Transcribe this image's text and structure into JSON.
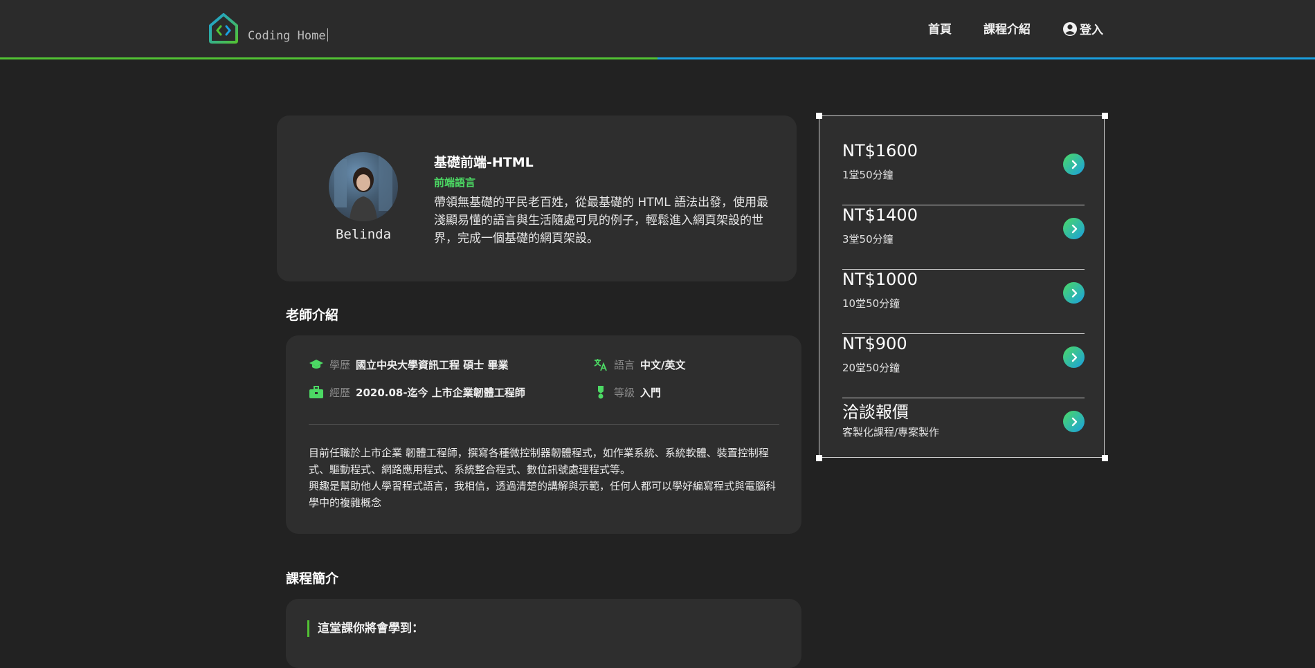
{
  "header": {
    "brand": "Coding Home",
    "nav": [
      {
        "label": "首頁"
      },
      {
        "label": "課程介紹"
      },
      {
        "label": "登入"
      }
    ],
    "accent_colors": [
      "#52c234",
      "#1a9fe0"
    ]
  },
  "course": {
    "teacher_name": "Belinda",
    "title": "基礎前端-HTML",
    "tag": "前端語言",
    "description": "帶領無基礎的平民老百姓，從最基礎的 HTML 語法出發，使用最淺顯易懂的語言與生活隨處可見的例子，輕鬆進入網頁架設的世界，完成一個基礎的網頁架設。"
  },
  "teacher_section": {
    "heading": "老師介紹",
    "education": {
      "icon": "graduation-cap-icon",
      "label": "學歷",
      "value": "國立中央大學資訊工程 碩士 畢業"
    },
    "language": {
      "icon": "translate-icon",
      "label": "語言",
      "value": "中文/英文"
    },
    "experience": {
      "icon": "briefcase-icon",
      "label": "經歷",
      "value": "2020.08-迄今 上市企業韌體工程師"
    },
    "level": {
      "icon": "award-icon",
      "label": "等級",
      "value": "入門"
    },
    "bio_line1": "目前任職於上市企業 韌體工程師，撰寫各種微控制器韌體程式，如作業系統、系統軟體、裝置控制程式、驅動程式、網路應用程式、系統整合程式、數位訊號處理程式等。",
    "bio_line2": "興趣是幫助他人學習程式語言，我相信，透過清楚的講解與示範，任何人都可以學好編寫程式與電腦科學中的複雜概念"
  },
  "intro_section": {
    "heading": "課程簡介",
    "subheading": "這堂課你將會學到："
  },
  "pricing": [
    {
      "price": "NT$1600",
      "detail": "1堂50分鐘"
    },
    {
      "price": "NT$1400",
      "detail": "3堂50分鐘"
    },
    {
      "price": "NT$1000",
      "detail": "10堂50分鐘"
    },
    {
      "price": "NT$900",
      "detail": "20堂50分鐘"
    },
    {
      "price": "洽談報價",
      "detail": "客製化課程/專案製作"
    }
  ]
}
